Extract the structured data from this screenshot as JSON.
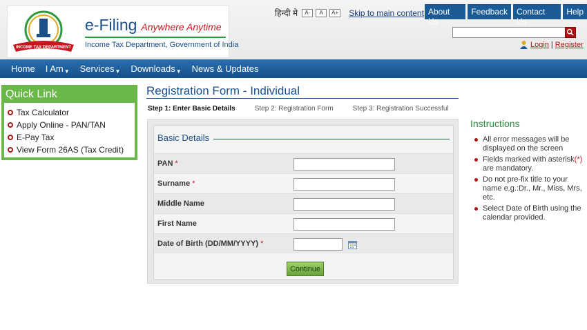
{
  "header": {
    "brand_name": "e-Filing",
    "brand_tagline": "Anywhere Anytime",
    "brand_subtitle": "Income Tax Department, Government of India",
    "emblem_text": "INCOME TAX DEPARTMENT",
    "language_link": "हिन्दी मे",
    "font_sizes": [
      "A-",
      "A",
      "A+"
    ],
    "skip_link": "Skip to main content",
    "top_nav": [
      "About Us",
      "Feedback",
      "Contact Us",
      "Help"
    ],
    "search_placeholder": "",
    "login_label": "Login",
    "register_label": "Register",
    "separator": "|"
  },
  "main_nav": [
    {
      "label": "Home",
      "dropdown": false
    },
    {
      "label": "I Am",
      "dropdown": true
    },
    {
      "label": "Services",
      "dropdown": true
    },
    {
      "label": "Downloads",
      "dropdown": true
    },
    {
      "label": "News & Updates",
      "dropdown": false
    }
  ],
  "quick_link": {
    "title": "Quick Link",
    "items": [
      "Tax Calculator",
      "Apply Online - PAN/TAN",
      "E-Pay Tax",
      "View Form 26AS (Tax Credit)"
    ]
  },
  "form": {
    "title": "Registration Form - Individual",
    "steps": [
      {
        "label": "Step 1: Enter Basic Details",
        "active": true
      },
      {
        "label": "Step 2: Registration Form",
        "active": false
      },
      {
        "label": "Step 3: Registration Successful",
        "active": false
      }
    ],
    "section_title": "Basic Details",
    "fields": [
      {
        "label": "PAN",
        "required": true,
        "value": ""
      },
      {
        "label": "Surname",
        "required": true,
        "value": ""
      },
      {
        "label": "Middle Name",
        "required": false,
        "value": ""
      },
      {
        "label": "First Name",
        "required": false,
        "value": ""
      },
      {
        "label": "Date of Birth (DD/MM/YYYY)",
        "required": true,
        "value": ""
      }
    ],
    "required_mark": "*",
    "continue_label": "Continue"
  },
  "instructions": {
    "title": "Instructions",
    "items": [
      "All error messages will be displayed on the screen",
      "Fields marked with asterisk",
      "Do not pre-fix title to your name e.g.:Dr., Mr., Miss, Mrs, etc.",
      "Select Date of Birth using the calendar provided."
    ],
    "asterisk_text": "(*)",
    "asterisk_suffix": "are mandatory."
  },
  "colors": {
    "brand_blue": "#1a4f8b",
    "nav_blue": "#1a5a96",
    "quick_green": "#6bb84a",
    "accent_red": "#c7161e"
  }
}
